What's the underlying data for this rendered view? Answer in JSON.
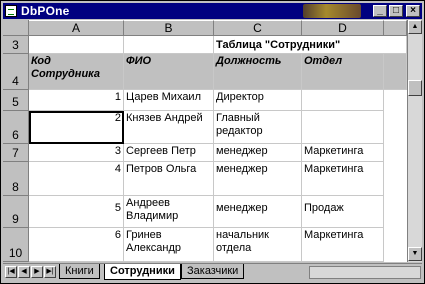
{
  "window": {
    "title": "DbPOne",
    "buttons": {
      "minimize": "_",
      "maximize": "□",
      "close": "×"
    }
  },
  "columns": [
    "A",
    "B",
    "C",
    "D"
  ],
  "rows": [
    {
      "num": "3",
      "cells": [
        "",
        "",
        "Таблица \"Сотрудники\"",
        ""
      ]
    },
    {
      "num": "4",
      "cells": [
        "Код Сотрудника",
        "ФИО",
        "Должность",
        "Отдел"
      ]
    },
    {
      "num": "5",
      "cells": [
        "1",
        "Царев Михаил",
        "Директор",
        ""
      ]
    },
    {
      "num": "6",
      "cells": [
        "2",
        "Князев Андрей",
        "Главный редактор",
        ""
      ]
    },
    {
      "num": "7",
      "cells": [
        "3",
        "Сергеев Петр",
        "менеджер",
        "Маркетинга"
      ]
    },
    {
      "num": "8",
      "cells": [
        "4",
        "Петров Ольга",
        "менеджер",
        "Маркетинга"
      ]
    },
    {
      "num": "9",
      "cells": [
        "5",
        "Андреев Владимир",
        "менеджер",
        "Продаж"
      ]
    },
    {
      "num": "10",
      "cells": [
        "6",
        "Гринев Александр",
        "начальник отдела",
        "Маркетинга"
      ]
    }
  ],
  "tabs": [
    {
      "label": "Книги",
      "active": false
    },
    {
      "label": "Сотрудники",
      "active": true
    },
    {
      "label": "Заказчики",
      "active": false
    }
  ],
  "nav_icons": [
    "first-sheet-icon",
    "prev-sheet-icon",
    "next-sheet-icon",
    "last-sheet-icon"
  ]
}
